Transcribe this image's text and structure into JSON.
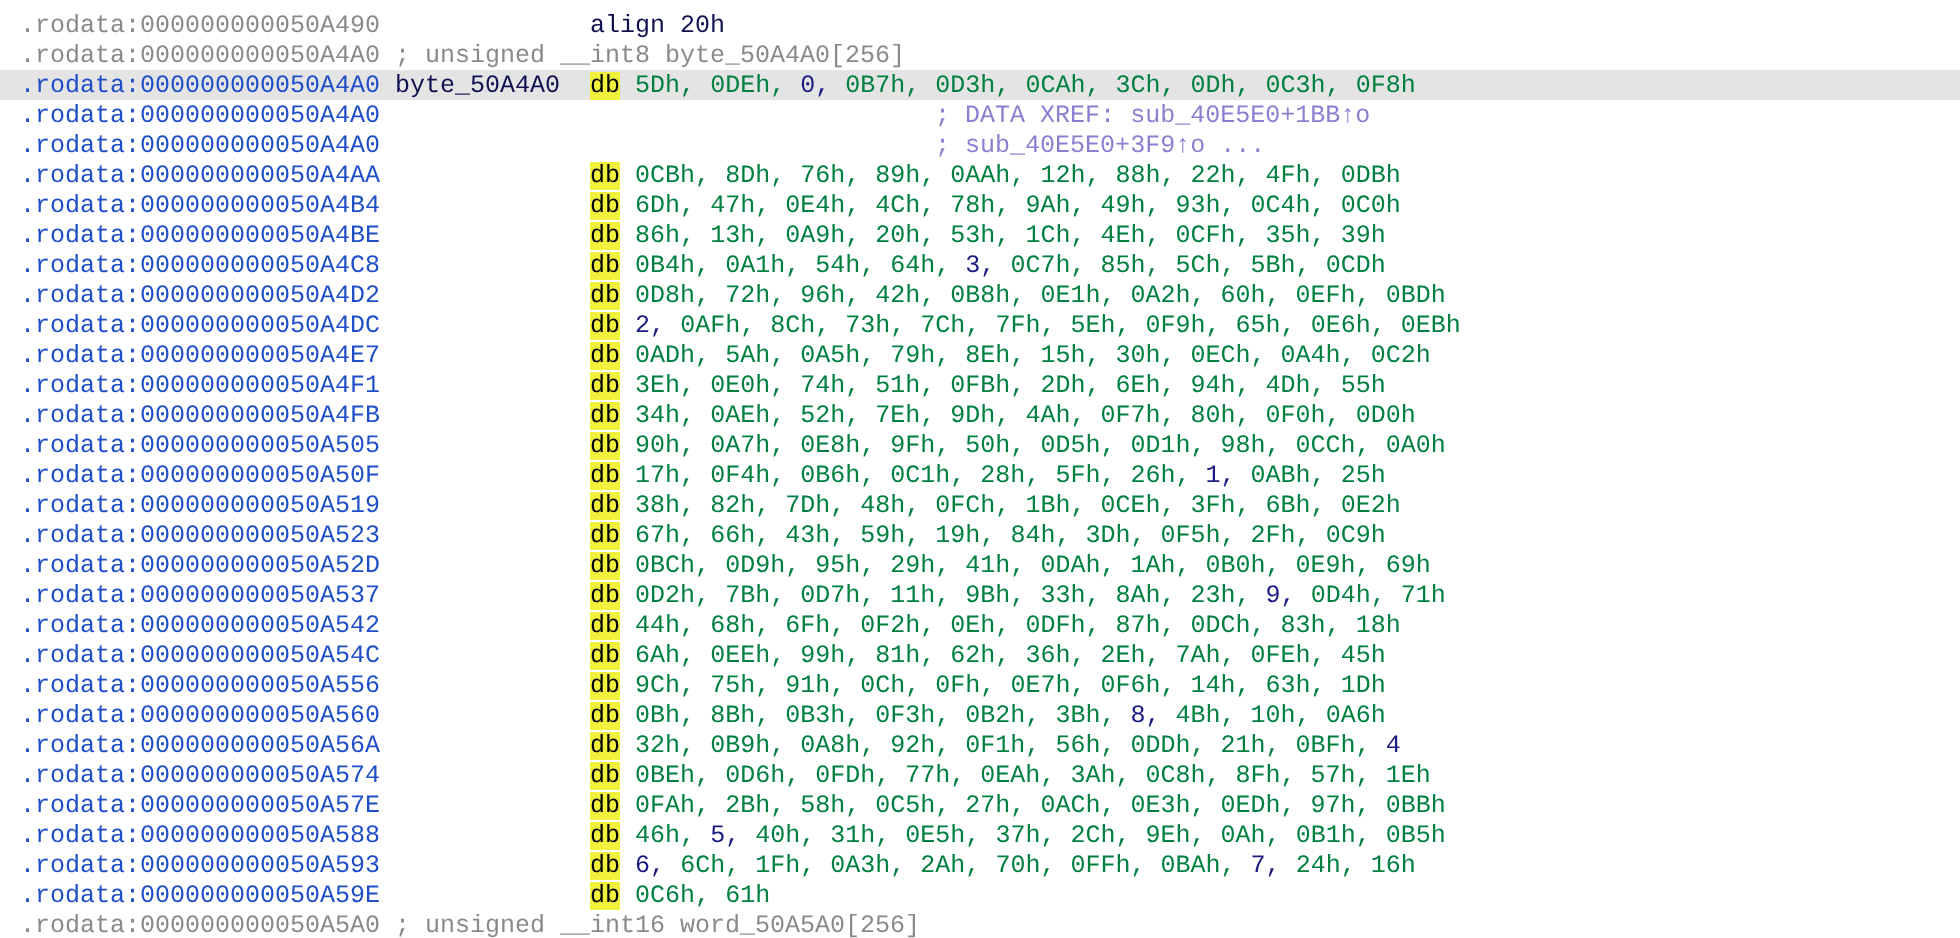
{
  "listing": [
    {
      "kind": "directive",
      "selected": false,
      "address": ".rodata:000000000050A490",
      "text": "align 20h"
    },
    {
      "kind": "comment",
      "selected": false,
      "address": ".rodata:000000000050A4A0",
      "comment": "; unsigned __int8 byte_50A4A0[256]"
    },
    {
      "kind": "data",
      "selected": true,
      "address": ".rodata:000000000050A4A0",
      "label": "byte_50A4A0",
      "mnemonic": "db",
      "highlighted": true,
      "operands": [
        {
          "text": "5Dh,",
          "kind": "hex"
        },
        {
          "text": "0DEh,",
          "kind": "hex"
        },
        {
          "text": "0,",
          "kind": "dec"
        },
        {
          "text": "0B7h,",
          "kind": "hex"
        },
        {
          "text": "0D3h,",
          "kind": "hex"
        },
        {
          "text": "0CAh,",
          "kind": "hex"
        },
        {
          "text": "3Ch,",
          "kind": "hex"
        },
        {
          "text": "0Dh,",
          "kind": "hex"
        },
        {
          "text": "0C3h,",
          "kind": "hex"
        },
        {
          "text": "0F8h",
          "kind": "hex"
        }
      ]
    },
    {
      "kind": "xref",
      "selected": false,
      "address": ".rodata:000000000050A4A0",
      "comment": "; DATA XREF: sub_40E5E0+1BB↑o"
    },
    {
      "kind": "xref",
      "selected": false,
      "address": ".rodata:000000000050A4A0",
      "comment": "; sub_40E5E0+3F9↑o ..."
    },
    {
      "kind": "data",
      "selected": false,
      "address": ".rodata:000000000050A4AA",
      "mnemonic": "db",
      "highlighted": true,
      "operands": [
        {
          "text": "0CBh,",
          "kind": "hex"
        },
        {
          "text": "8Dh,",
          "kind": "hex"
        },
        {
          "text": "76h,",
          "kind": "hex"
        },
        {
          "text": "89h,",
          "kind": "hex"
        },
        {
          "text": "0AAh,",
          "kind": "hex"
        },
        {
          "text": "12h,",
          "kind": "hex"
        },
        {
          "text": "88h,",
          "kind": "hex"
        },
        {
          "text": "22h,",
          "kind": "hex"
        },
        {
          "text": "4Fh,",
          "kind": "hex"
        },
        {
          "text": "0DBh",
          "kind": "hex"
        }
      ]
    },
    {
      "kind": "data",
      "selected": false,
      "address": ".rodata:000000000050A4B4",
      "mnemonic": "db",
      "highlighted": true,
      "operands": [
        {
          "text": "6Dh,",
          "kind": "hex"
        },
        {
          "text": "47h,",
          "kind": "hex"
        },
        {
          "text": "0E4h,",
          "kind": "hex"
        },
        {
          "text": "4Ch,",
          "kind": "hex"
        },
        {
          "text": "78h,",
          "kind": "hex"
        },
        {
          "text": "9Ah,",
          "kind": "hex"
        },
        {
          "text": "49h,",
          "kind": "hex"
        },
        {
          "text": "93h,",
          "kind": "hex"
        },
        {
          "text": "0C4h,",
          "kind": "hex"
        },
        {
          "text": "0C0h",
          "kind": "hex"
        }
      ]
    },
    {
      "kind": "data",
      "selected": false,
      "address": ".rodata:000000000050A4BE",
      "mnemonic": "db",
      "highlighted": true,
      "operands": [
        {
          "text": "86h,",
          "kind": "hex"
        },
        {
          "text": "13h,",
          "kind": "hex"
        },
        {
          "text": "0A9h,",
          "kind": "hex"
        },
        {
          "text": "20h,",
          "kind": "hex"
        },
        {
          "text": "53h,",
          "kind": "hex"
        },
        {
          "text": "1Ch,",
          "kind": "hex"
        },
        {
          "text": "4Eh,",
          "kind": "hex"
        },
        {
          "text": "0CFh,",
          "kind": "hex"
        },
        {
          "text": "35h,",
          "kind": "hex"
        },
        {
          "text": "39h",
          "kind": "hex"
        }
      ]
    },
    {
      "kind": "data",
      "selected": false,
      "address": ".rodata:000000000050A4C8",
      "mnemonic": "db",
      "highlighted": true,
      "operands": [
        {
          "text": "0B4h,",
          "kind": "hex"
        },
        {
          "text": "0A1h,",
          "kind": "hex"
        },
        {
          "text": "54h,",
          "kind": "hex"
        },
        {
          "text": "64h,",
          "kind": "hex"
        },
        {
          "text": "3,",
          "kind": "dec"
        },
        {
          "text": "0C7h,",
          "kind": "hex"
        },
        {
          "text": "85h,",
          "kind": "hex"
        },
        {
          "text": "5Ch,",
          "kind": "hex"
        },
        {
          "text": "5Bh,",
          "kind": "hex"
        },
        {
          "text": "0CDh",
          "kind": "hex"
        }
      ]
    },
    {
      "kind": "data",
      "selected": false,
      "address": ".rodata:000000000050A4D2",
      "mnemonic": "db",
      "highlighted": true,
      "operands": [
        {
          "text": "0D8h,",
          "kind": "hex"
        },
        {
          "text": "72h,",
          "kind": "hex"
        },
        {
          "text": "96h,",
          "kind": "hex"
        },
        {
          "text": "42h,",
          "kind": "hex"
        },
        {
          "text": "0B8h,",
          "kind": "hex"
        },
        {
          "text": "0E1h,",
          "kind": "hex"
        },
        {
          "text": "0A2h,",
          "kind": "hex"
        },
        {
          "text": "60h,",
          "kind": "hex"
        },
        {
          "text": "0EFh,",
          "kind": "hex"
        },
        {
          "text": "0BDh",
          "kind": "hex"
        }
      ]
    },
    {
      "kind": "data",
      "selected": false,
      "address": ".rodata:000000000050A4DC",
      "mnemonic": "db",
      "highlighted": true,
      "operands": [
        {
          "text": "2,",
          "kind": "dec"
        },
        {
          "text": "0AFh,",
          "kind": "hex"
        },
        {
          "text": "8Ch,",
          "kind": "hex"
        },
        {
          "text": "73h,",
          "kind": "hex"
        },
        {
          "text": "7Ch,",
          "kind": "hex"
        },
        {
          "text": "7Fh,",
          "kind": "hex"
        },
        {
          "text": "5Eh,",
          "kind": "hex"
        },
        {
          "text": "0F9h,",
          "kind": "hex"
        },
        {
          "text": "65h,",
          "kind": "hex"
        },
        {
          "text": "0E6h,",
          "kind": "hex"
        },
        {
          "text": "0EBh",
          "kind": "hex"
        }
      ]
    },
    {
      "kind": "data",
      "selected": false,
      "address": ".rodata:000000000050A4E7",
      "mnemonic": "db",
      "highlighted": true,
      "operands": [
        {
          "text": "0ADh,",
          "kind": "hex"
        },
        {
          "text": "5Ah,",
          "kind": "hex"
        },
        {
          "text": "0A5h,",
          "kind": "hex"
        },
        {
          "text": "79h,",
          "kind": "hex"
        },
        {
          "text": "8Eh,",
          "kind": "hex"
        },
        {
          "text": "15h,",
          "kind": "hex"
        },
        {
          "text": "30h,",
          "kind": "hex"
        },
        {
          "text": "0ECh,",
          "kind": "hex"
        },
        {
          "text": "0A4h,",
          "kind": "hex"
        },
        {
          "text": "0C2h",
          "kind": "hex"
        }
      ]
    },
    {
      "kind": "data",
      "selected": false,
      "address": ".rodata:000000000050A4F1",
      "mnemonic": "db",
      "highlighted": true,
      "operands": [
        {
          "text": "3Eh,",
          "kind": "hex"
        },
        {
          "text": "0E0h,",
          "kind": "hex"
        },
        {
          "text": "74h,",
          "kind": "hex"
        },
        {
          "text": "51h,",
          "kind": "hex"
        },
        {
          "text": "0FBh,",
          "kind": "hex"
        },
        {
          "text": "2Dh,",
          "kind": "hex"
        },
        {
          "text": "6Eh,",
          "kind": "hex"
        },
        {
          "text": "94h,",
          "kind": "hex"
        },
        {
          "text": "4Dh,",
          "kind": "hex"
        },
        {
          "text": "55h",
          "kind": "hex"
        }
      ]
    },
    {
      "kind": "data",
      "selected": false,
      "address": ".rodata:000000000050A4FB",
      "mnemonic": "db",
      "highlighted": true,
      "operands": [
        {
          "text": "34h,",
          "kind": "hex"
        },
        {
          "text": "0AEh,",
          "kind": "hex"
        },
        {
          "text": "52h,",
          "kind": "hex"
        },
        {
          "text": "7Eh,",
          "kind": "hex"
        },
        {
          "text": "9Dh,",
          "kind": "hex"
        },
        {
          "text": "4Ah,",
          "kind": "hex"
        },
        {
          "text": "0F7h,",
          "kind": "hex"
        },
        {
          "text": "80h,",
          "kind": "hex"
        },
        {
          "text": "0F0h,",
          "kind": "hex"
        },
        {
          "text": "0D0h",
          "kind": "hex"
        }
      ]
    },
    {
      "kind": "data",
      "selected": false,
      "address": ".rodata:000000000050A505",
      "mnemonic": "db",
      "highlighted": true,
      "operands": [
        {
          "text": "90h,",
          "kind": "hex"
        },
        {
          "text": "0A7h,",
          "kind": "hex"
        },
        {
          "text": "0E8h,",
          "kind": "hex"
        },
        {
          "text": "9Fh,",
          "kind": "hex"
        },
        {
          "text": "50h,",
          "kind": "hex"
        },
        {
          "text": "0D5h,",
          "kind": "hex"
        },
        {
          "text": "0D1h,",
          "kind": "hex"
        },
        {
          "text": "98h,",
          "kind": "hex"
        },
        {
          "text": "0CCh,",
          "kind": "hex"
        },
        {
          "text": "0A0h",
          "kind": "hex"
        }
      ]
    },
    {
      "kind": "data",
      "selected": false,
      "address": ".rodata:000000000050A50F",
      "mnemonic": "db",
      "highlighted": true,
      "operands": [
        {
          "text": "17h,",
          "kind": "hex"
        },
        {
          "text": "0F4h,",
          "kind": "hex"
        },
        {
          "text": "0B6h,",
          "kind": "hex"
        },
        {
          "text": "0C1h,",
          "kind": "hex"
        },
        {
          "text": "28h,",
          "kind": "hex"
        },
        {
          "text": "5Fh,",
          "kind": "hex"
        },
        {
          "text": "26h,",
          "kind": "hex"
        },
        {
          "text": "1,",
          "kind": "dec"
        },
        {
          "text": "0ABh,",
          "kind": "hex"
        },
        {
          "text": "25h",
          "kind": "hex"
        }
      ]
    },
    {
      "kind": "data",
      "selected": false,
      "address": ".rodata:000000000050A519",
      "mnemonic": "db",
      "highlighted": true,
      "operands": [
        {
          "text": "38h,",
          "kind": "hex"
        },
        {
          "text": "82h,",
          "kind": "hex"
        },
        {
          "text": "7Dh,",
          "kind": "hex"
        },
        {
          "text": "48h,",
          "kind": "hex"
        },
        {
          "text": "0FCh,",
          "kind": "hex"
        },
        {
          "text": "1Bh,",
          "kind": "hex"
        },
        {
          "text": "0CEh,",
          "kind": "hex"
        },
        {
          "text": "3Fh,",
          "kind": "hex"
        },
        {
          "text": "6Bh,",
          "kind": "hex"
        },
        {
          "text": "0E2h",
          "kind": "hex"
        }
      ]
    },
    {
      "kind": "data",
      "selected": false,
      "address": ".rodata:000000000050A523",
      "mnemonic": "db",
      "highlighted": true,
      "operands": [
        {
          "text": "67h,",
          "kind": "hex"
        },
        {
          "text": "66h,",
          "kind": "hex"
        },
        {
          "text": "43h,",
          "kind": "hex"
        },
        {
          "text": "59h,",
          "kind": "hex"
        },
        {
          "text": "19h,",
          "kind": "hex"
        },
        {
          "text": "84h,",
          "kind": "hex"
        },
        {
          "text": "3Dh,",
          "kind": "hex"
        },
        {
          "text": "0F5h,",
          "kind": "hex"
        },
        {
          "text": "2Fh,",
          "kind": "hex"
        },
        {
          "text": "0C9h",
          "kind": "hex"
        }
      ]
    },
    {
      "kind": "data",
      "selected": false,
      "address": ".rodata:000000000050A52D",
      "mnemonic": "db",
      "highlighted": true,
      "operands": [
        {
          "text": "0BCh,",
          "kind": "hex"
        },
        {
          "text": "0D9h,",
          "kind": "hex"
        },
        {
          "text": "95h,",
          "kind": "hex"
        },
        {
          "text": "29h,",
          "kind": "hex"
        },
        {
          "text": "41h,",
          "kind": "hex"
        },
        {
          "text": "0DAh,",
          "kind": "hex"
        },
        {
          "text": "1Ah,",
          "kind": "hex"
        },
        {
          "text": "0B0h,",
          "kind": "hex"
        },
        {
          "text": "0E9h,",
          "kind": "hex"
        },
        {
          "text": "69h",
          "kind": "hex"
        }
      ]
    },
    {
      "kind": "data",
      "selected": false,
      "address": ".rodata:000000000050A537",
      "mnemonic": "db",
      "highlighted": true,
      "operands": [
        {
          "text": "0D2h,",
          "kind": "hex"
        },
        {
          "text": "7Bh,",
          "kind": "hex"
        },
        {
          "text": "0D7h,",
          "kind": "hex"
        },
        {
          "text": "11h,",
          "kind": "hex"
        },
        {
          "text": "9Bh,",
          "kind": "hex"
        },
        {
          "text": "33h,",
          "kind": "hex"
        },
        {
          "text": "8Ah,",
          "kind": "hex"
        },
        {
          "text": "23h,",
          "kind": "hex"
        },
        {
          "text": "9,",
          "kind": "dec"
        },
        {
          "text": "0D4h,",
          "kind": "hex"
        },
        {
          "text": "71h",
          "kind": "hex"
        }
      ]
    },
    {
      "kind": "data",
      "selected": false,
      "address": ".rodata:000000000050A542",
      "mnemonic": "db",
      "highlighted": true,
      "operands": [
        {
          "text": "44h,",
          "kind": "hex"
        },
        {
          "text": "68h,",
          "kind": "hex"
        },
        {
          "text": "6Fh,",
          "kind": "hex"
        },
        {
          "text": "0F2h,",
          "kind": "hex"
        },
        {
          "text": "0Eh,",
          "kind": "hex"
        },
        {
          "text": "0DFh,",
          "kind": "hex"
        },
        {
          "text": "87h,",
          "kind": "hex"
        },
        {
          "text": "0DCh,",
          "kind": "hex"
        },
        {
          "text": "83h,",
          "kind": "hex"
        },
        {
          "text": "18h",
          "kind": "hex"
        }
      ]
    },
    {
      "kind": "data",
      "selected": false,
      "address": ".rodata:000000000050A54C",
      "mnemonic": "db",
      "highlighted": true,
      "operands": [
        {
          "text": "6Ah,",
          "kind": "hex"
        },
        {
          "text": "0EEh,",
          "kind": "hex"
        },
        {
          "text": "99h,",
          "kind": "hex"
        },
        {
          "text": "81h,",
          "kind": "hex"
        },
        {
          "text": "62h,",
          "kind": "hex"
        },
        {
          "text": "36h,",
          "kind": "hex"
        },
        {
          "text": "2Eh,",
          "kind": "hex"
        },
        {
          "text": "7Ah,",
          "kind": "hex"
        },
        {
          "text": "0FEh,",
          "kind": "hex"
        },
        {
          "text": "45h",
          "kind": "hex"
        }
      ]
    },
    {
      "kind": "data",
      "selected": false,
      "address": ".rodata:000000000050A556",
      "mnemonic": "db",
      "highlighted": true,
      "operands": [
        {
          "text": "9Ch,",
          "kind": "hex"
        },
        {
          "text": "75h,",
          "kind": "hex"
        },
        {
          "text": "91h,",
          "kind": "hex"
        },
        {
          "text": "0Ch,",
          "kind": "hex"
        },
        {
          "text": "0Fh,",
          "kind": "hex"
        },
        {
          "text": "0E7h,",
          "kind": "hex"
        },
        {
          "text": "0F6h,",
          "kind": "hex"
        },
        {
          "text": "14h,",
          "kind": "hex"
        },
        {
          "text": "63h,",
          "kind": "hex"
        },
        {
          "text": "1Dh",
          "kind": "hex"
        }
      ]
    },
    {
      "kind": "data",
      "selected": false,
      "address": ".rodata:000000000050A560",
      "mnemonic": "db",
      "highlighted": true,
      "operands": [
        {
          "text": "0Bh,",
          "kind": "hex"
        },
        {
          "text": "8Bh,",
          "kind": "hex"
        },
        {
          "text": "0B3h,",
          "kind": "hex"
        },
        {
          "text": "0F3h,",
          "kind": "hex"
        },
        {
          "text": "0B2h,",
          "kind": "hex"
        },
        {
          "text": "3Bh,",
          "kind": "hex"
        },
        {
          "text": "8,",
          "kind": "dec"
        },
        {
          "text": "4Bh,",
          "kind": "hex"
        },
        {
          "text": "10h,",
          "kind": "hex"
        },
        {
          "text": "0A6h",
          "kind": "hex"
        }
      ]
    },
    {
      "kind": "data",
      "selected": false,
      "address": ".rodata:000000000050A56A",
      "mnemonic": "db",
      "highlighted": true,
      "operands": [
        {
          "text": "32h,",
          "kind": "hex"
        },
        {
          "text": "0B9h,",
          "kind": "hex"
        },
        {
          "text": "0A8h,",
          "kind": "hex"
        },
        {
          "text": "92h,",
          "kind": "hex"
        },
        {
          "text": "0F1h,",
          "kind": "hex"
        },
        {
          "text": "56h,",
          "kind": "hex"
        },
        {
          "text": "0DDh,",
          "kind": "hex"
        },
        {
          "text": "21h,",
          "kind": "hex"
        },
        {
          "text": "0BFh,",
          "kind": "hex"
        },
        {
          "text": "4",
          "kind": "dec"
        }
      ]
    },
    {
      "kind": "data",
      "selected": false,
      "address": ".rodata:000000000050A574",
      "mnemonic": "db",
      "highlighted": true,
      "operands": [
        {
          "text": "0BEh,",
          "kind": "hex"
        },
        {
          "text": "0D6h,",
          "kind": "hex"
        },
        {
          "text": "0FDh,",
          "kind": "hex"
        },
        {
          "text": "77h,",
          "kind": "hex"
        },
        {
          "text": "0EAh,",
          "kind": "hex"
        },
        {
          "text": "3Ah,",
          "kind": "hex"
        },
        {
          "text": "0C8h,",
          "kind": "hex"
        },
        {
          "text": "8Fh,",
          "kind": "hex"
        },
        {
          "text": "57h,",
          "kind": "hex"
        },
        {
          "text": "1Eh",
          "kind": "hex"
        }
      ]
    },
    {
      "kind": "data",
      "selected": false,
      "address": ".rodata:000000000050A57E",
      "mnemonic": "db",
      "highlighted": true,
      "operands": [
        {
          "text": "0FAh,",
          "kind": "hex"
        },
        {
          "text": "2Bh,",
          "kind": "hex"
        },
        {
          "text": "58h,",
          "kind": "hex"
        },
        {
          "text": "0C5h,",
          "kind": "hex"
        },
        {
          "text": "27h,",
          "kind": "hex"
        },
        {
          "text": "0ACh,",
          "kind": "hex"
        },
        {
          "text": "0E3h,",
          "kind": "hex"
        },
        {
          "text": "0EDh,",
          "kind": "hex"
        },
        {
          "text": "97h,",
          "kind": "hex"
        },
        {
          "text": "0BBh",
          "kind": "hex"
        }
      ]
    },
    {
      "kind": "data",
      "selected": false,
      "address": ".rodata:000000000050A588",
      "mnemonic": "db",
      "highlighted": true,
      "operands": [
        {
          "text": "46h,",
          "kind": "hex"
        },
        {
          "text": "5,",
          "kind": "dec"
        },
        {
          "text": "40h,",
          "kind": "hex"
        },
        {
          "text": "31h,",
          "kind": "hex"
        },
        {
          "text": "0E5h,",
          "kind": "hex"
        },
        {
          "text": "37h,",
          "kind": "hex"
        },
        {
          "text": "2Ch,",
          "kind": "hex"
        },
        {
          "text": "9Eh,",
          "kind": "hex"
        },
        {
          "text": "0Ah,",
          "kind": "hex"
        },
        {
          "text": "0B1h,",
          "kind": "hex"
        },
        {
          "text": "0B5h",
          "kind": "hex"
        }
      ]
    },
    {
      "kind": "data",
      "selected": false,
      "address": ".rodata:000000000050A593",
      "mnemonic": "db",
      "highlighted": true,
      "operands": [
        {
          "text": "6,",
          "kind": "dec"
        },
        {
          "text": "6Ch,",
          "kind": "hex"
        },
        {
          "text": "1Fh,",
          "kind": "hex"
        },
        {
          "text": "0A3h,",
          "kind": "hex"
        },
        {
          "text": "2Ah,",
          "kind": "hex"
        },
        {
          "text": "70h,",
          "kind": "hex"
        },
        {
          "text": "0FFh,",
          "kind": "hex"
        },
        {
          "text": "0BAh,",
          "kind": "hex"
        },
        {
          "text": "7,",
          "kind": "dec"
        },
        {
          "text": "24h,",
          "kind": "hex"
        },
        {
          "text": "16h",
          "kind": "hex"
        }
      ]
    },
    {
      "kind": "data",
      "selected": false,
      "address": ".rodata:000000000050A59E",
      "mnemonic": "db",
      "highlighted": true,
      "operands": [
        {
          "text": "0C6h,",
          "kind": "hex"
        },
        {
          "text": "61h",
          "kind": "hex"
        }
      ]
    },
    {
      "kind": "comment",
      "selected": false,
      "address": ".rodata:000000000050A5A0",
      "comment": "; unsigned __int16 word_50A5A0[256]"
    }
  ]
}
